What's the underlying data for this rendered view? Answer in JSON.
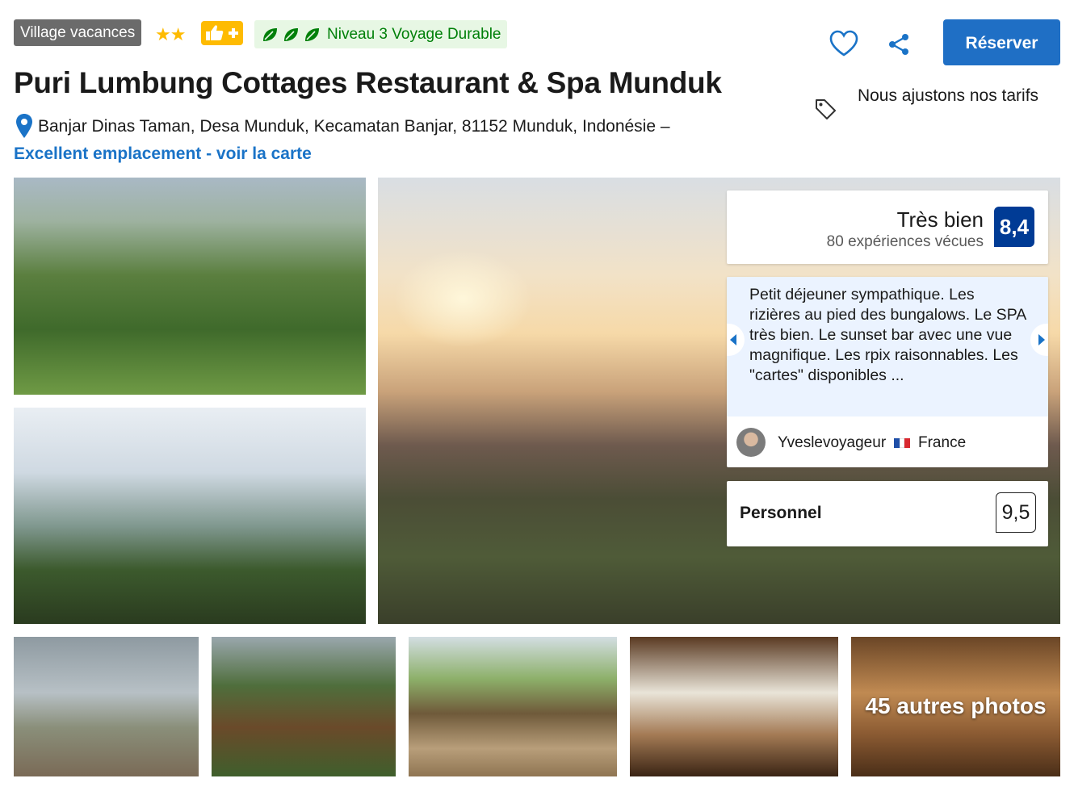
{
  "header": {
    "type_badge": "Village vacances",
    "stars": "★★",
    "sustainability_label": "Niveau 3 Voyage Durable",
    "title": "Puri Lumbung Cottages Restaurant & Spa Munduk",
    "address": "Banjar Dinas Taman, Desa Munduk, Kecamatan Banjar, 81152 Munduk, Indonésie –",
    "map_link": "Excellent emplacement - voir la carte"
  },
  "actions": {
    "reserve_label": "Réserver",
    "price_note": "Nous ajustons nos tarifs",
    "icons": [
      "heart-icon",
      "share-icon",
      "price-tag-icon"
    ]
  },
  "rating": {
    "label": "Très bien",
    "count": "80 expériences vécues",
    "score": "8,4"
  },
  "review": {
    "text": "Petit déjeuner sympathique. Les rizières au pied des bungalows. Le SPA très bien. Le sunset bar avec une vue magnifique. Les rpix raisonnables. Les \"cartes\" disponibles ...",
    "reviewer": "Yveslevoyageur",
    "country": "France"
  },
  "category": {
    "label": "Personnel",
    "score": "9,5"
  },
  "gallery": {
    "more_photos": "45 autres photos"
  },
  "colors": {
    "brand_blue": "#1f6fc5",
    "score_blue": "#003b95",
    "link_blue": "#1a73c7",
    "star_yellow": "#febb02",
    "sustain_green": "#008009"
  }
}
